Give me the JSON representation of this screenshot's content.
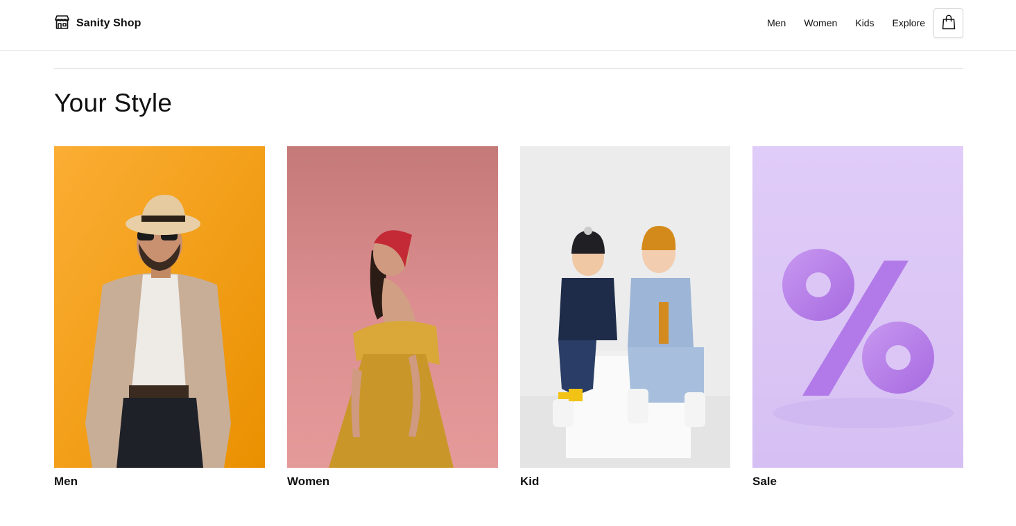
{
  "header": {
    "brand_name": "Sanity Shop",
    "nav": [
      {
        "label": "Men"
      },
      {
        "label": "Women"
      },
      {
        "label": "Kids"
      },
      {
        "label": "Explore"
      }
    ],
    "icons": {
      "brand": "storefront-icon",
      "cart": "shopping-bag-icon"
    }
  },
  "main": {
    "title": "Your Style",
    "categories": [
      {
        "label": "Men",
        "image": "men-category-photo",
        "bg_color": "#f6a623"
      },
      {
        "label": "Women",
        "image": "women-category-photo",
        "bg_color": "#d98a8a"
      },
      {
        "label": "Kid",
        "image": "kids-category-photo",
        "bg_color": "#ececec"
      },
      {
        "label": "Sale",
        "image": "sale-percent-graphic",
        "bg_color": "#dccbf6"
      }
    ]
  },
  "colors": {
    "text": "#111111",
    "border": "#e4e4e4",
    "background": "#ffffff"
  }
}
